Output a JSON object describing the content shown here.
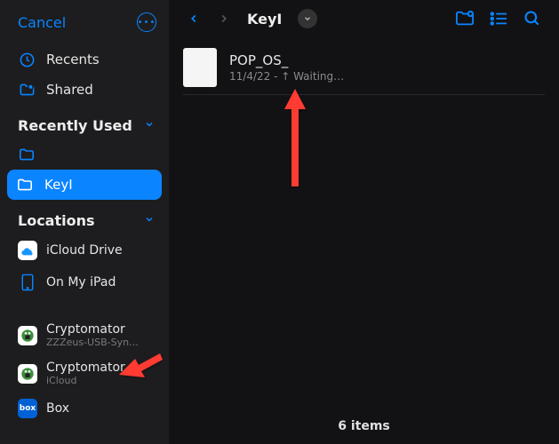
{
  "header": {
    "cancel": "Cancel",
    "more_icon": "…"
  },
  "sidebar": {
    "recents": "Recents",
    "shared": "Shared",
    "recently_used": "Recently Used",
    "folder_keyi": "KeyI",
    "locations": "Locations",
    "icloud_drive": "iCloud Drive",
    "on_my_ipad": "On My iPad",
    "crypto1": {
      "name": "Cryptomator",
      "sub": "ZZZeus-USB-Syn…"
    },
    "crypto2": {
      "name": "Cryptomator",
      "sub": "iCloud"
    },
    "box": "Box"
  },
  "main": {
    "breadcrumb": "KeyI",
    "file": {
      "name": "POP_OS_",
      "meta": "11/4/22 - ↑ Waiting…"
    },
    "footer": "6 items"
  }
}
